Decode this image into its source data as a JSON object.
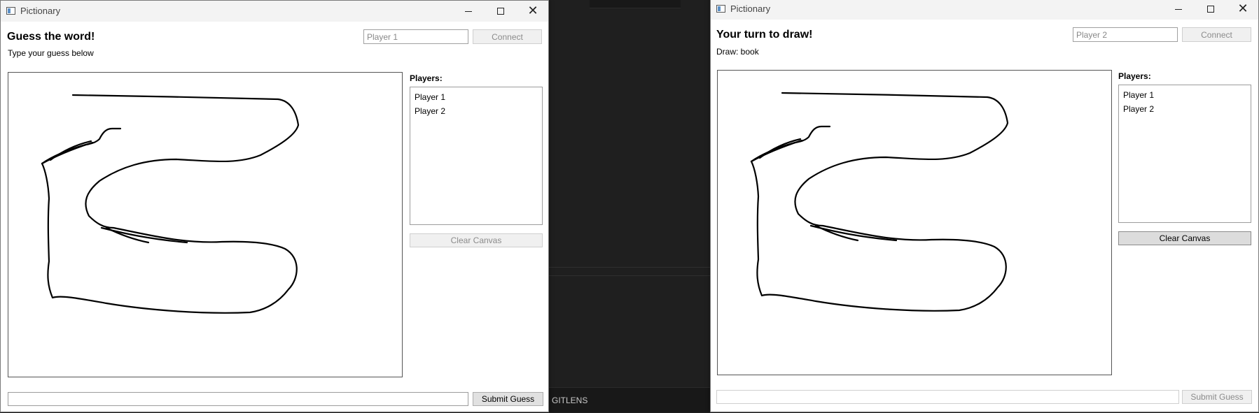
{
  "background": {
    "status_text": "GITLENS"
  },
  "window_left": {
    "title": "Pictionary",
    "heading": "Guess the word!",
    "subtext": "Type your guess below",
    "name_placeholder": "Player 1",
    "connect_label": "Connect",
    "players_label": "Players:",
    "players": [
      "Player 1",
      "Player 2"
    ],
    "clear_label": "Clear Canvas",
    "guess_value": "",
    "submit_label": "Submit Guess"
  },
  "window_right": {
    "title": "Pictionary",
    "heading": "Your turn to draw!",
    "subtext": "Draw: book",
    "name_placeholder": "Player 2",
    "connect_label": "Connect",
    "players_label": "Players:",
    "players": [
      "Player 1",
      "Player 2"
    ],
    "clear_label": "Clear Canvas",
    "guess_value": "",
    "submit_label": "Submit Guess"
  },
  "colors": {
    "titlebar": "#f3f3f3",
    "desktop": "#1f1f1f",
    "stroke": "#000000"
  }
}
